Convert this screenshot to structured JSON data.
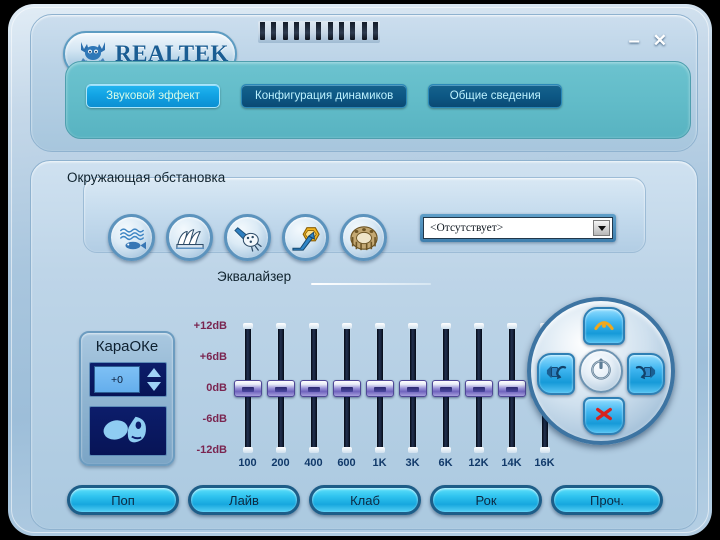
{
  "window": {
    "brand": "REALTEK",
    "minimize_label": "–",
    "close_label": "✕",
    "logo_icon": "realtek-mascot-icon"
  },
  "tabs": [
    {
      "label": "Звуковой эффект",
      "active": true
    },
    {
      "label": "Конфигурация динамиков",
      "active": false
    },
    {
      "label": "Общие сведения",
      "active": false
    }
  ],
  "environment": {
    "title": "Окружающая обстановка",
    "selected_value": "<Отсутствует>",
    "presets": [
      {
        "icon": "underwater-fish-icon"
      },
      {
        "icon": "opera-house-icon"
      },
      {
        "icon": "bathroom-shower-icon"
      },
      {
        "icon": "arena-icon"
      },
      {
        "icon": "coliseum-icon"
      }
    ]
  },
  "karaoke": {
    "title": "КараОКе",
    "pitch_value": "+0",
    "up_icon": "triangle-up-icon",
    "down_icon": "triangle-down-icon",
    "vocal_icon": "vocal-cancel-icon"
  },
  "equalizer": {
    "title": "Эквалайзер",
    "scale_labels": [
      "+12dB",
      "+6dB",
      "0dB",
      "-6dB",
      "-12dB"
    ],
    "band_labels": [
      "100",
      "200",
      "400",
      "600",
      "1K",
      "3K",
      "6K",
      "12K",
      "14K",
      "16K"
    ]
  },
  "chart_data": {
    "type": "bar",
    "title": "Эквалайзер",
    "categories": [
      "100",
      "200",
      "400",
      "600",
      "1K",
      "3K",
      "6K",
      "12K",
      "14K",
      "16K"
    ],
    "values": [
      0,
      0,
      0,
      0,
      0,
      0,
      0,
      0,
      0,
      0
    ],
    "xlabel": "",
    "ylabel": "dB",
    "ylim": [
      -12,
      12
    ],
    "ytick_labels": [
      "+12dB",
      "+6dB",
      "0dB",
      "-6dB",
      "-12dB"
    ],
    "ytick_values": [
      12,
      6,
      0,
      -6,
      -12
    ],
    "grid": false,
    "legend": "none"
  },
  "dpad": {
    "up_icon": "ceiling-speaker-icon",
    "left_icon": "speaker-left-icon",
    "right_icon": "speaker-right-icon",
    "down_icon": "mute-x-icon",
    "center_icon": "power-icon"
  },
  "presets": [
    {
      "label": "Поп"
    },
    {
      "label": "Лайв"
    },
    {
      "label": "Клаб"
    },
    {
      "label": "Рок"
    },
    {
      "label": "Проч."
    }
  ]
}
